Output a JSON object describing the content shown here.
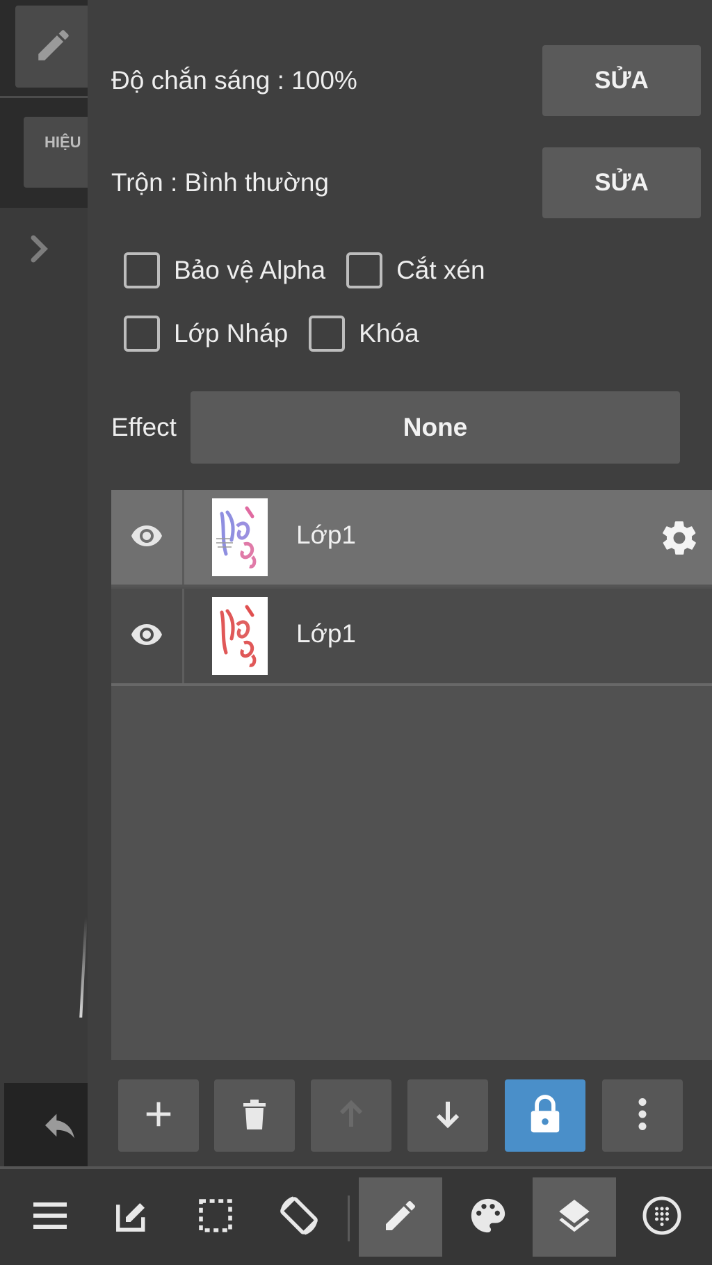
{
  "left_strip": {
    "effect_button_label": "HIỆU"
  },
  "properties": {
    "opacity_label": "Độ chắn sáng : 100%",
    "opacity_edit_label": "SỬA",
    "blend_label": "Trộn : Bình thường",
    "blend_edit_label": "SỬA",
    "checkboxes": {
      "alpha_protect": "Bảo vệ Alpha",
      "clipping": "Cắt xén",
      "draft_layer": "Lớp Nháp",
      "lock": "Khóa"
    },
    "effect_label": "Effect",
    "effect_value": "None"
  },
  "layers": [
    {
      "name": "Lớp1",
      "selected": true
    },
    {
      "name": "Lớp1",
      "selected": false
    }
  ],
  "colors": {
    "accent_active": "#4a8fc9",
    "panel_bg": "#3f3f3f",
    "selected_row": "#707070"
  },
  "icons": {
    "toolbar": [
      "plus-icon",
      "trash-icon",
      "arrow-up-icon",
      "arrow-down-icon",
      "lock-icon",
      "more-vertical-icon"
    ],
    "nav": [
      "menu-icon",
      "edit-icon",
      "selection-icon",
      "rotate-icon",
      "pen-icon",
      "palette-icon",
      "layers-icon",
      "grid-icon"
    ]
  }
}
